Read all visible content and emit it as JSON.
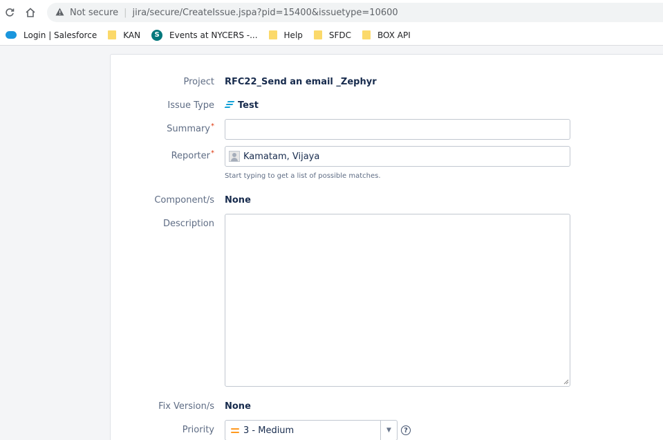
{
  "browser": {
    "security_label": "Not secure",
    "url": "jira/secure/CreateIssue.jspa?pid=15400&issuetype=10600"
  },
  "bookmarks": [
    {
      "label": "Login | Salesforce",
      "icon": "salesforce-icon"
    },
    {
      "label": "KAN",
      "icon": "folder-icon"
    },
    {
      "label": "Events at NYCERS -...",
      "icon": "sharepoint-icon"
    },
    {
      "label": "Help",
      "icon": "folder-icon"
    },
    {
      "label": "SFDC",
      "icon": "folder-icon"
    },
    {
      "label": "BOX API",
      "icon": "folder-icon"
    }
  ],
  "form": {
    "project": {
      "label": "Project",
      "value": "RFC22_Send an email _Zephyr"
    },
    "issue_type": {
      "label": "Issue Type",
      "value": "Test",
      "icon": "zephyr-test-icon"
    },
    "summary": {
      "label": "Summary",
      "required_mark": "*",
      "value": ""
    },
    "reporter": {
      "label": "Reporter",
      "required_mark": "*",
      "value": "Kamatam, Vijaya",
      "help": "Start typing to get a list of possible matches."
    },
    "components": {
      "label": "Component/s",
      "value": "None"
    },
    "description": {
      "label": "Description",
      "value": ""
    },
    "fix_versions": {
      "label": "Fix Version/s",
      "value": "None"
    },
    "priority": {
      "label": "Priority",
      "value": "3 - Medium",
      "color": "#ff991f"
    }
  }
}
